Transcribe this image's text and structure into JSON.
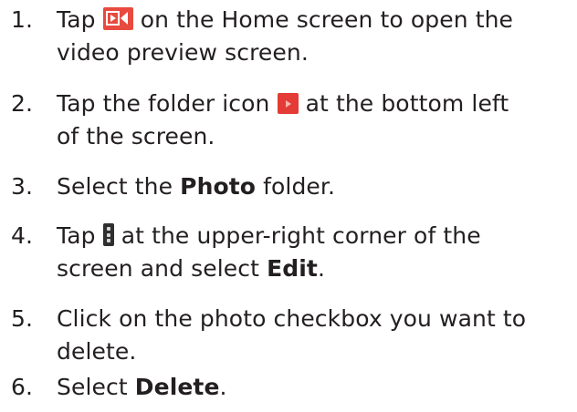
{
  "steps": [
    {
      "number": "1.",
      "line1_a": "Tap ",
      "line1_b": " on the Home screen to open the",
      "line2": "video preview screen.",
      "icon": "video-preview-icon"
    },
    {
      "number": "2.",
      "line1_a": "Tap the folder icon ",
      "line1_b": " at the bottom left",
      "line2": "of the screen.",
      "icon": "folder-icon"
    },
    {
      "number": "3.",
      "line1_a": "Select the ",
      "line1_bold": "Photo",
      "line1_b": " folder."
    },
    {
      "number": "4.",
      "line1_a": "Tap ",
      "line1_b": " at the upper-right corner of the",
      "line2_a": "screen and select ",
      "line2_bold": "Edit",
      "line2_b": ".",
      "icon": "more-options-icon"
    },
    {
      "number": "5.",
      "line1": "Click on the photo checkbox you want to",
      "line2": "delete."
    },
    {
      "number": "6.",
      "line1_a": "Select ",
      "line1_bold": "Delete",
      "line1_b": "."
    }
  ],
  "colors": {
    "text": "#231f20",
    "video_icon_bg": "#e84a3f",
    "folder_icon_bg": "#e43b36",
    "menu_icon_bg": "#2f2f2f"
  }
}
